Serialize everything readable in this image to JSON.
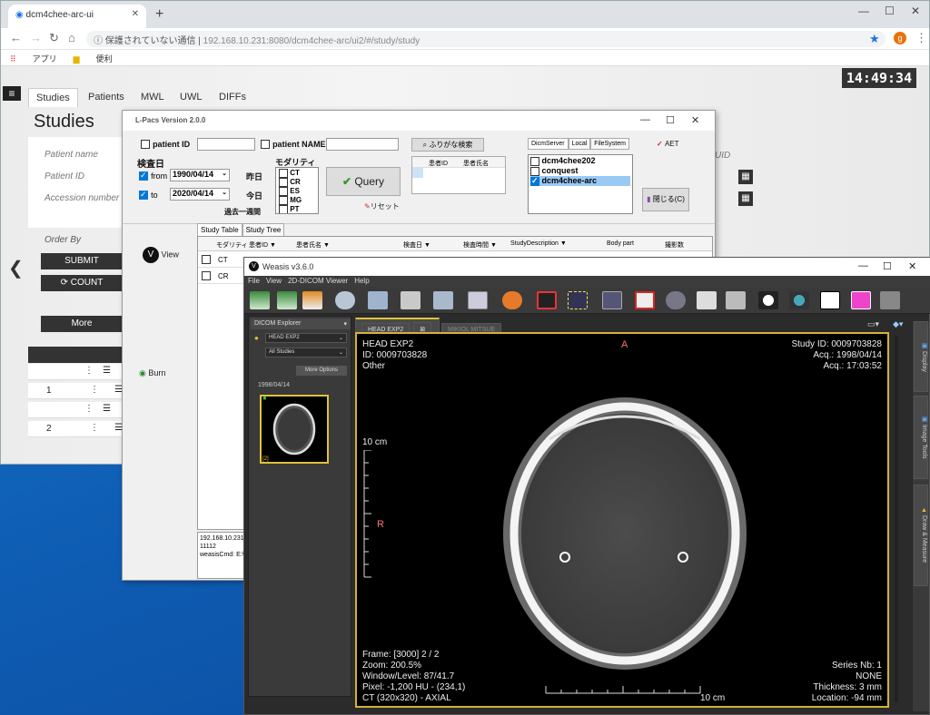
{
  "browser": {
    "tab_title": "dcm4chee-arc-ui",
    "url_security": "保護されていない通信",
    "url": "192.168.10.231:8080/dcm4chee-arc/ui2/#/study/study",
    "avatar_letter": "g",
    "bookmarks": [
      "アプリ",
      "便利"
    ]
  },
  "app": {
    "clock": "14:49:34",
    "tabs": [
      "Studies",
      "Patients",
      "MWL",
      "UWL",
      "DIFFs"
    ],
    "page_title": "Studies",
    "fields": [
      "Patient name",
      "Patient ID",
      "Accession number"
    ],
    "uid_label": "UID",
    "order_by": "Order By",
    "submit": "SUBMIT",
    "count": "COUNT",
    "more": "More",
    "rows": [
      "",
      "1",
      "",
      "2"
    ]
  },
  "lpacs": {
    "title": "L-Pacs Version  2.0.0",
    "patient_id": "patient ID",
    "patient_name": "patient NAME",
    "exam_date": "検査日",
    "from_label": "from",
    "from_date": "1990/04/14",
    "to_label": "to",
    "to_date": "2020/04/14",
    "yesterday": "昨日",
    "today": "今日",
    "past_week": "過去一週間",
    "modality": "モダリティ",
    "modalities": [
      "CT",
      "CR",
      "ES",
      "MG",
      "PT"
    ],
    "query": "Query",
    "reset": "リセット",
    "furigana": "ふりがな検索",
    "patient_table_headers": [
      "患者ID",
      "患者氏名"
    ],
    "server_tabs": [
      "DicmServer",
      "Local",
      "FileSystem"
    ],
    "servers": [
      "dcm4chee202",
      "conquest",
      "dcm4chee-arc"
    ],
    "aet": "AET",
    "close": "閉じる(C)",
    "view": "View",
    "burn": "Burn",
    "study_tabs": [
      "Study Table",
      "Study Tree"
    ],
    "grid_headers": [
      "モダリティ",
      "患者ID ▼",
      "患者氏名 ▼",
      "検査日 ▼",
      "検査時間 ▼",
      "StudyDescription ▼",
      "Body part",
      "撮影数"
    ],
    "grid_rows": [
      "CT",
      "CR"
    ],
    "log": "192.168.10.231\n11112\nweasisCmd: E:\\"
  },
  "weasis": {
    "title": "Weasis v3.6.0",
    "menu": [
      "File",
      "View",
      "2D-DICOM Viewer",
      "Help"
    ],
    "explorer": "DICOM Explorer",
    "patient_select": "HEAD EXP2",
    "studies_select": "All Studies",
    "more_options": "More Options",
    "thumb_date": "1998/04/14",
    "thumb_badge": "[2]",
    "view_tab_active": "HEAD EXP2",
    "view_tab_other": "MIKIOL MITSUE",
    "top_left": [
      "HEAD EXP2",
      "ID: 0009703828",
      "Other"
    ],
    "top_right": [
      "Study ID: 0009703828",
      "Acq.: 1998/04/14",
      "Acq.: 17:03:52"
    ],
    "bottom_left": [
      "Frame: [3000] 2 / 2",
      "Zoom: 200.5%",
      "Window/Level: 87/41.7",
      "Pixel: -1,200 HU - (234,1)",
      "CT (320x320) - AXIAL"
    ],
    "bottom_right": [
      "Series Nb: 1",
      "NONE",
      "Thickness: 3 mm",
      "Location: -94 mm"
    ],
    "orient_top": "A",
    "orient_left": "R",
    "scale_vertical": "10 cm",
    "scale_horizontal": "10 cm",
    "side_tabs": [
      "Display",
      "Image Tools",
      "Draw & Measure"
    ]
  }
}
